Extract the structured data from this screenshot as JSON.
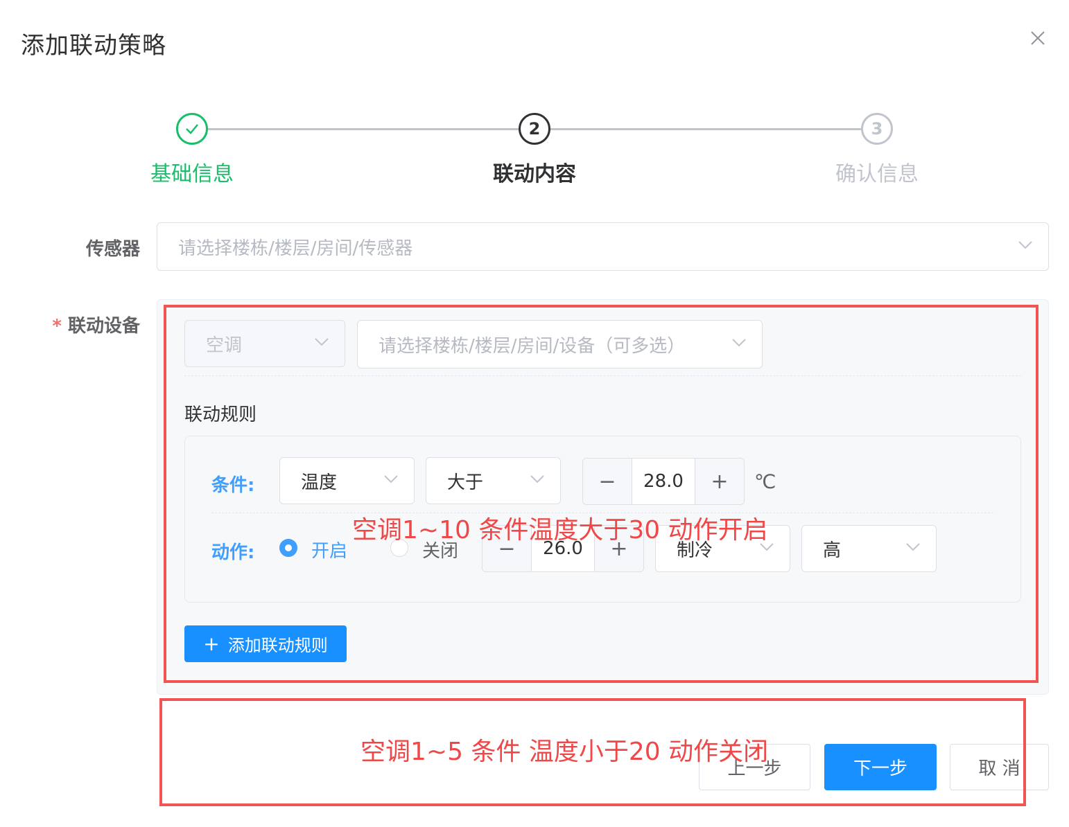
{
  "dialog": {
    "title": "添加联动策略"
  },
  "steps": [
    {
      "number": "1",
      "label": "基础信息",
      "status": "finished"
    },
    {
      "number": "2",
      "label": "联动内容",
      "status": "active"
    },
    {
      "number": "3",
      "label": "确认信息",
      "status": "waiting"
    }
  ],
  "sensor": {
    "label": "传感器",
    "placeholder": "请选择楼栋/楼层/房间/传感器"
  },
  "device": {
    "required_mark": "*",
    "label": "联动设备",
    "type_value": "空调",
    "target_placeholder": "请选择楼栋/楼层/房间/设备（可多选）",
    "rules_title": "联动规则",
    "condition": {
      "label": "条件:",
      "field": "温度",
      "operator": "大于",
      "minus": "−",
      "value": "28.0",
      "plus": "+",
      "unit": "℃"
    },
    "action": {
      "label": "动作:",
      "option_on": "开启",
      "option_off": "关闭",
      "selected": "开启",
      "minus": "−",
      "value": "26.0",
      "plus": "+",
      "mode": "制冷",
      "fan": "高"
    },
    "add_rule_button": "添加联动规则",
    "add_rule_icon": "+"
  },
  "footer": {
    "prev": "上一步",
    "next": "下一步",
    "cancel": "取 消"
  },
  "annotations": {
    "note1": "空调1~10 条件温度大于30 动作开启",
    "note2": "空调1~5  条件 温度小于20 动作关闭"
  },
  "colors": {
    "finished": "#19be6b",
    "active": "#303133",
    "waiting": "#c0c4cc",
    "primary": "#1890ff",
    "annotation": "#f04848"
  }
}
